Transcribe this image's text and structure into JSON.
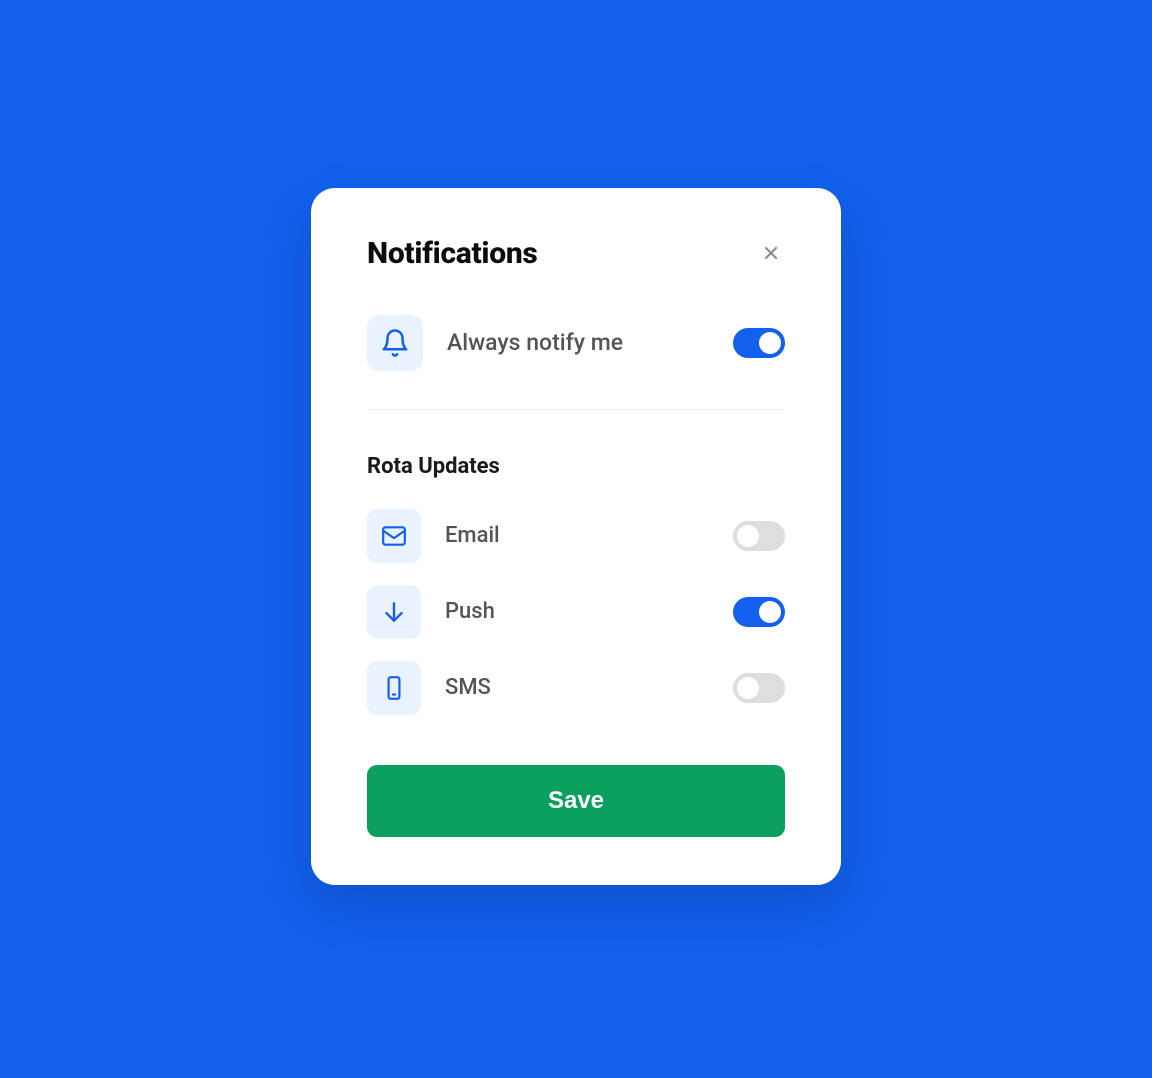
{
  "modal": {
    "title": "Notifications",
    "always_notify": {
      "label": "Always notify me",
      "enabled": true
    },
    "section": {
      "title": "Rota Updates",
      "options": [
        {
          "label": "Email",
          "icon": "envelope",
          "enabled": false
        },
        {
          "label": "Push",
          "icon": "arrow-down",
          "enabled": true
        },
        {
          "label": "SMS",
          "icon": "phone",
          "enabled": false
        }
      ]
    },
    "save_label": "Save"
  }
}
